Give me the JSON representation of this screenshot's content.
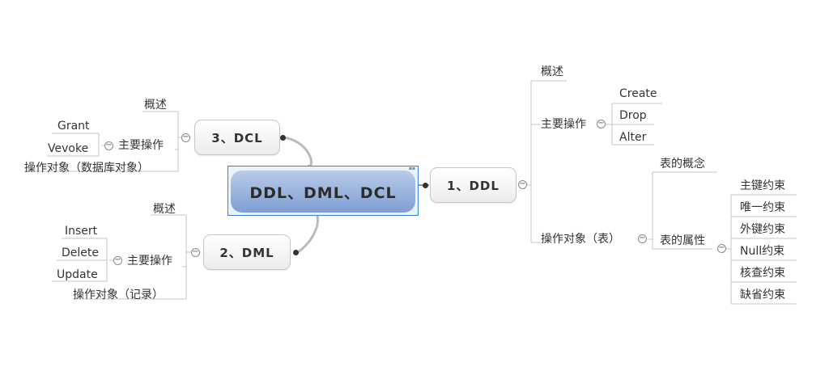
{
  "central": {
    "label": "DDL、DML、DCL"
  },
  "ddl": {
    "label": "1、DDL",
    "overview": "概述",
    "main_ops": {
      "label": "主要操作",
      "items": [
        "Create",
        "Drop",
        "Alter"
      ]
    },
    "objects": {
      "label": "操作对象（表）",
      "concept": "表的概念",
      "attrs": {
        "label": "表的属性",
        "items": [
          "主键约束",
          "唯一约束",
          "外键约束",
          "Null约束",
          "核查约束",
          "缺省约束"
        ]
      }
    }
  },
  "dml": {
    "label": "2、DML",
    "overview": "概述",
    "main_ops": {
      "label": "主要操作",
      "items": [
        "Insert",
        "Delete",
        "Update"
      ]
    },
    "objects": "操作对象（记录）"
  },
  "dcl": {
    "label": "3、DCL",
    "overview": "概述",
    "main_ops": {
      "label": "主要操作",
      "items": [
        "Grant",
        "Vevoke"
      ]
    },
    "objects": "操作对象（数据库对象）"
  },
  "collapse_symbol": "−"
}
